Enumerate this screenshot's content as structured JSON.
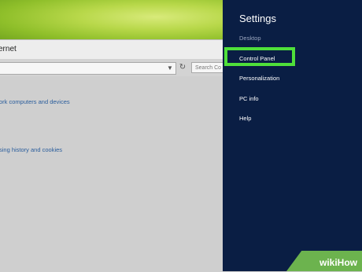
{
  "window": {
    "title": "ernet",
    "search_placeholder": "Search Co",
    "links": [
      "ork computers and devices",
      "sing history and cookies"
    ]
  },
  "charm": {
    "title": "Settings",
    "items": [
      {
        "label": "Desktop"
      },
      {
        "label": "Control Panel"
      },
      {
        "label": "Personalization"
      },
      {
        "label": "PC info"
      },
      {
        "label": "Help"
      }
    ]
  },
  "watermark": {
    "text": "wikiHow"
  },
  "colors": {
    "charm_bg": "#0a1e44",
    "highlight": "#4fe03a",
    "link": "#2a5d9c"
  }
}
